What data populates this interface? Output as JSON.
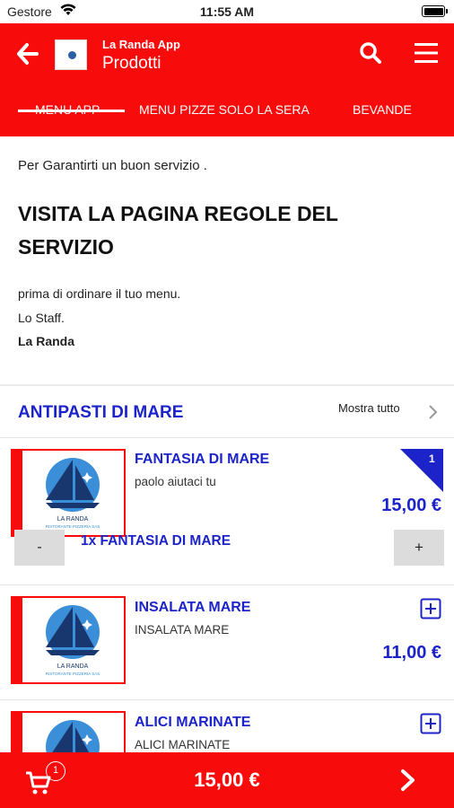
{
  "status_bar": {
    "carrier": "Gestore",
    "time": "11:55 AM"
  },
  "header": {
    "app_name": "La Randa App",
    "title": "Prodotti",
    "tabs": [
      {
        "label": "MENU APP",
        "active": true
      },
      {
        "label": "MENU PIZZE SOLO LA SERA",
        "active": false
      },
      {
        "label": "BEVANDE",
        "active": false
      }
    ]
  },
  "notice": {
    "line1": "Per Garantirti un buon servizio .",
    "heading": "VISITA LA PAGINA REGOLE DEL SERVIZIO",
    "p1": "prima di ordinare il tuo menu.",
    "p2": "Lo Staff.",
    "p3": "La Randa"
  },
  "category": {
    "title": "ANTIPASTI DI MARE",
    "show_all": "Mostra tutto"
  },
  "products": [
    {
      "name": "FANTASIA DI MARE",
      "description": "paolo aiutaci tu",
      "price": "15,00 €",
      "in_cart_count": "1",
      "quantity_label": "1x FANTASIA DI MARE",
      "minus_label": "-",
      "plus_label": "+"
    },
    {
      "name": "INSALATA MARE",
      "description": "INSALATA MARE",
      "price": "11,00 €"
    },
    {
      "name": "ALICI MARINATE",
      "description": "ALICI MARINATE",
      "price": ""
    }
  ],
  "logo_caption": {
    "line1": "LA RANDA",
    "line2": "RISTORANTE PIZZERIA SAS"
  },
  "bottom_bar": {
    "cart_count": "1",
    "total": "15,00 €"
  },
  "colors": {
    "brand_red": "#f70b0b",
    "accent_blue": "#1c24c9",
    "button_gray": "#dcdcdc"
  }
}
